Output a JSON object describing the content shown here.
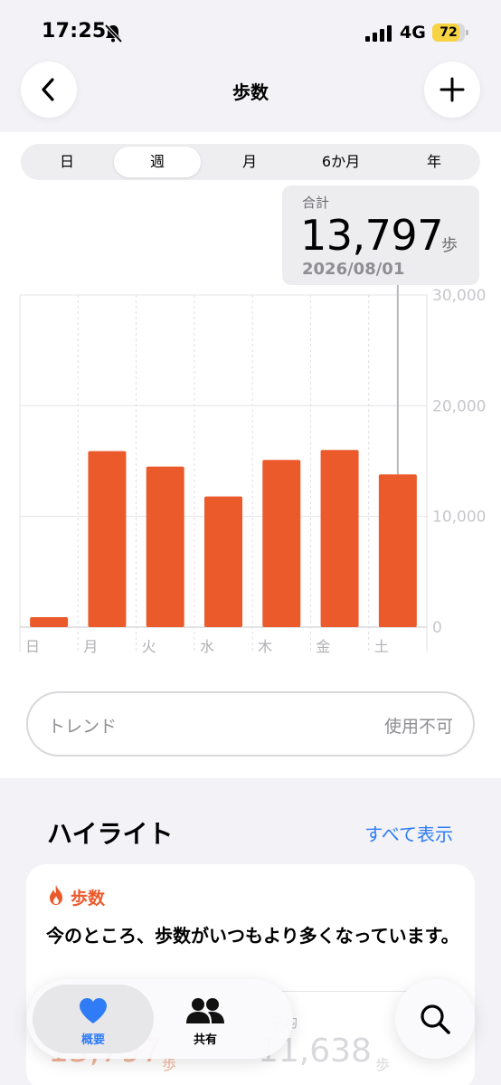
{
  "status_bar": {
    "time": "17:25",
    "network": "4G",
    "battery": "72",
    "battery_color": "#f7d343"
  },
  "nav": {
    "title": "歩数",
    "back_icon": "chevron-left-icon",
    "add_icon": "plus-icon"
  },
  "segments": {
    "items": [
      "日",
      "週",
      "月",
      "6か月",
      "年"
    ],
    "selected": "週"
  },
  "tooltip": {
    "label": "合計",
    "value": "13,797",
    "unit": "歩",
    "date": "2026/08/01"
  },
  "chart_data": {
    "type": "bar",
    "categories": [
      "日",
      "月",
      "火",
      "水",
      "木",
      "金",
      "土"
    ],
    "values": [
      900,
      15900,
      14500,
      11800,
      15100,
      16000,
      13797
    ],
    "y_ticks": [
      "30,000",
      "20,000",
      "10,000",
      "0"
    ],
    "ylim": [
      0,
      30000
    ],
    "grid": true,
    "bar_color": "#eb5a2b",
    "highlighted_index": 6
  },
  "trend": {
    "label": "トレンド",
    "status": "使用不可"
  },
  "highlights": {
    "title": "ハイライト",
    "link": "すべて表示",
    "card": {
      "category": "歩数",
      "category_icon": "flame-icon",
      "text": "今のところ、歩数がいつもより多くなっています。",
      "left_value": "13,797",
      "left_unit": "歩",
      "right_label": "平均",
      "right_value": "11,638",
      "right_unit": "歩"
    }
  },
  "tabbar": {
    "tabs": [
      {
        "label": "概要",
        "icon": "heart-icon"
      },
      {
        "label": "共有",
        "icon": "people-icon"
      }
    ],
    "search_icon": "search-icon",
    "accent": "#2f7cf6"
  }
}
